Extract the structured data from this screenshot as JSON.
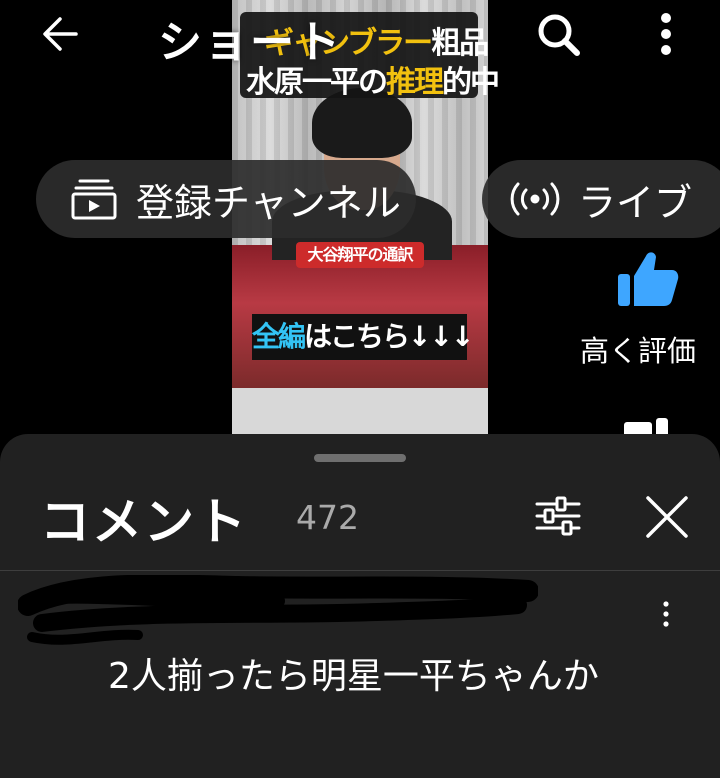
{
  "video": {
    "caption_line1_a": "ギャンブラー",
    "caption_line1_b": "粗品",
    "caption_line2_a": "水原一平の",
    "caption_line2_b": "推理",
    "caption_line2_c": "的中",
    "caption_sub": "大谷翔平の通訳",
    "caption_cta_a": "全編",
    "caption_cta_b": "はこちら↓↓↓"
  },
  "header": {
    "title": "ショート",
    "back_icon": "arrow-left-icon",
    "search_icon": "search-icon",
    "more_icon": "more-vertical-icon"
  },
  "chips": [
    {
      "label": "登録チャンネル",
      "icon": "subscriptions-icon"
    },
    {
      "label": "ライブ",
      "icon": "live-broadcast-icon"
    }
  ],
  "actions": {
    "like_label": "高く評価",
    "like_icon": "thumbs-up-icon",
    "like_color": "#3ea6ff"
  },
  "comments_panel": {
    "title": "コメント",
    "count": "472",
    "filter_icon": "sort-filter-icon",
    "close_icon": "close-icon",
    "items": [
      {
        "text": "2人揃ったら明星一平ちゃんか"
      }
    ]
  }
}
